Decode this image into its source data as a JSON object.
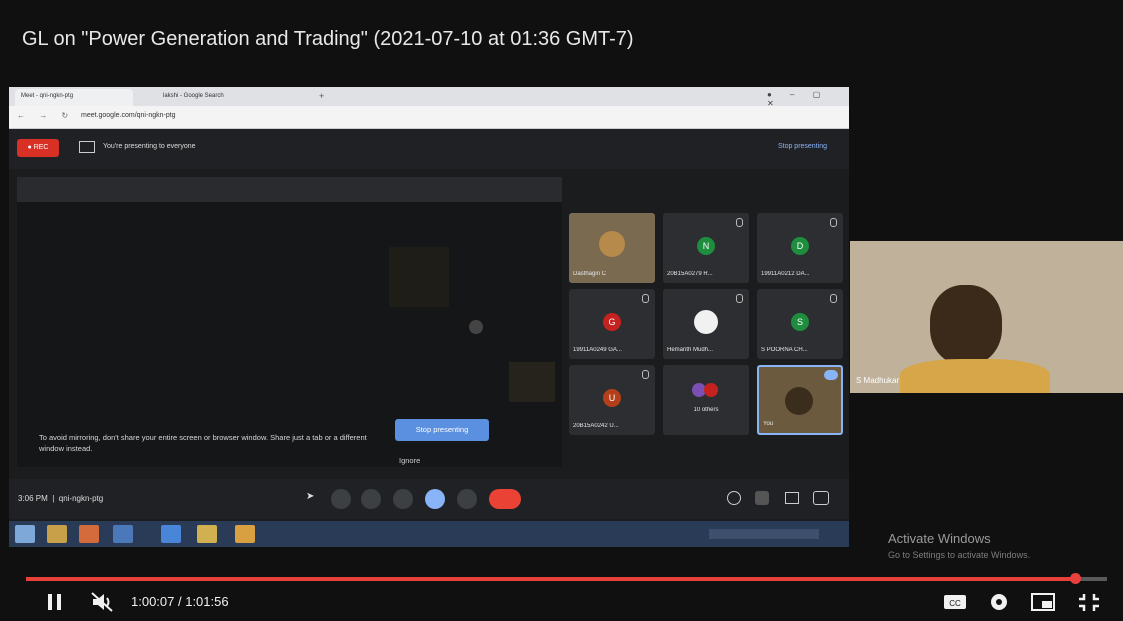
{
  "video": {
    "title": "GL on \"Power Generation and Trading\" (2021-07-10 at 01:36 GMT-7)",
    "current_time": "1:00:07",
    "duration": "1:01:56",
    "time_display": "1:00:07 / 1:01:56",
    "progress": 0.97
  },
  "browser": {
    "tabs": [
      {
        "label": "Meet - qni-ngkn-ptg"
      },
      {
        "label": "lakshi - Google Search"
      }
    ],
    "url": "meet.google.com/qni-ngkn-ptg"
  },
  "meet": {
    "rec_label": "REC",
    "presenting_text": "You're presenting to everyone",
    "stop_presenting_link": "Stop presenting",
    "warning_text": "To avoid mirroring, don't share your entire screen or browser window. Share just a tab or a different window instead.",
    "stop_button": "Stop presenting",
    "ignore": "Ignore",
    "clock": "3:06 PM",
    "meeting_code": "qni-ngkn-ptg",
    "participants": [
      {
        "name": "Dasthagiri C",
        "initial": "",
        "color": "#8a6a3a",
        "video": true
      },
      {
        "name": "20B15A0279 R...",
        "initial": "N",
        "color": "#1e8e3e"
      },
      {
        "name": "19911A0212 DA...",
        "initial": "D",
        "color": "#1e8e3e"
      },
      {
        "name": "19911A0249 GA...",
        "initial": "G",
        "color": "#c5221f"
      },
      {
        "name": "Hemanth Mudh...",
        "initial": "",
        "color": "#f1f1f1"
      },
      {
        "name": "S POORNA CH...",
        "initial": "S",
        "color": "#1e8e3e"
      },
      {
        "name": "20B15A0242 U...",
        "initial": "U",
        "color": "#b3401a"
      },
      {
        "name": "10 others",
        "initial": "",
        "color": "#7b4fb3"
      },
      {
        "name": "You",
        "initial": "",
        "color": "#a67c3d",
        "video": true
      }
    ]
  },
  "webcam": {
    "name": "S Madhukar"
  },
  "watermark": {
    "title": "Activate Windows",
    "subtitle": "Go to Settings to activate Windows."
  },
  "icons": [
    "pause-icon",
    "mute-icon",
    "cc-icon",
    "gear-icon",
    "miniplayer-icon",
    "exit-fullscreen-icon"
  ],
  "colors": {
    "progress": "#e8413c",
    "rec": "#d93025",
    "end_call": "#ea4335",
    "meet_blue": "#8ab4f8"
  }
}
